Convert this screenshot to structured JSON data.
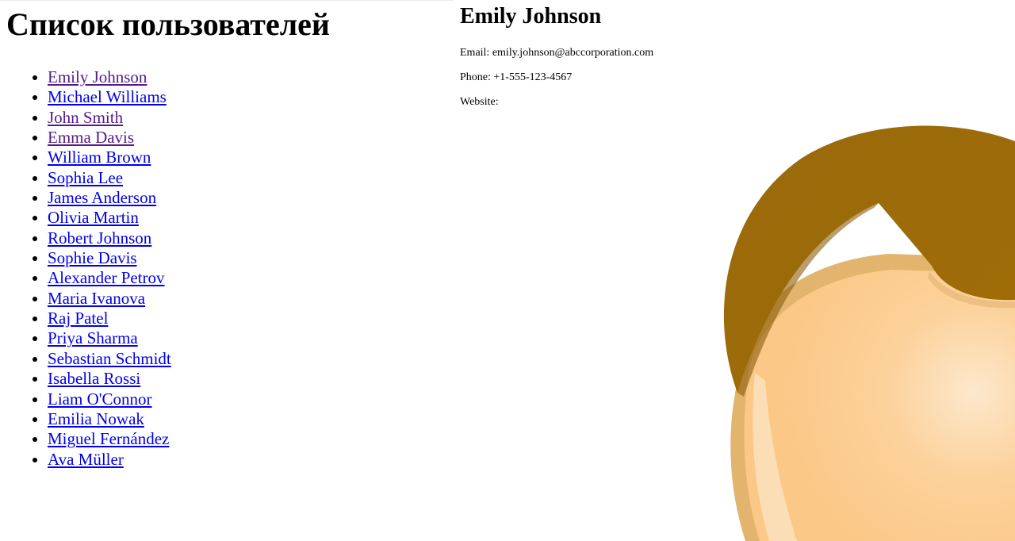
{
  "page": {
    "title": "Список пользователей"
  },
  "users": [
    {
      "name": "Emily Johnson",
      "visited": true
    },
    {
      "name": "Michael Williams",
      "visited": false
    },
    {
      "name": "John Smith",
      "visited": true
    },
    {
      "name": "Emma Davis",
      "visited": true
    },
    {
      "name": "William Brown",
      "visited": false
    },
    {
      "name": "Sophia Lee",
      "visited": false
    },
    {
      "name": "James Anderson",
      "visited": false
    },
    {
      "name": "Olivia Martin",
      "visited": false
    },
    {
      "name": "Robert Johnson",
      "visited": false
    },
    {
      "name": "Sophie Davis",
      "visited": false
    },
    {
      "name": "Alexander Petrov",
      "visited": false
    },
    {
      "name": "Maria Ivanova",
      "visited": false
    },
    {
      "name": "Raj Patel",
      "visited": false
    },
    {
      "name": "Priya Sharma",
      "visited": false
    },
    {
      "name": "Sebastian Schmidt",
      "visited": false
    },
    {
      "name": "Isabella Rossi",
      "visited": false
    },
    {
      "name": "Liam O'Connor",
      "visited": false
    },
    {
      "name": "Emilia Nowak",
      "visited": false
    },
    {
      "name": "Miguel Fernández",
      "visited": false
    },
    {
      "name": "Ava Müller",
      "visited": false
    }
  ],
  "detail": {
    "name": "Emily Johnson",
    "email": "Email: emily.johnson@abccorporation.com",
    "phone": "Phone: +1-555-123-4567",
    "website": "Website:",
    "avatar_icon": "default-user-avatar-icon"
  },
  "colors": {
    "link": "#0000ee",
    "link_visited": "#551a8b",
    "hair": "#9e6b0a",
    "skin": "#fcc98a",
    "skin_highlight": "#fde4c4"
  }
}
